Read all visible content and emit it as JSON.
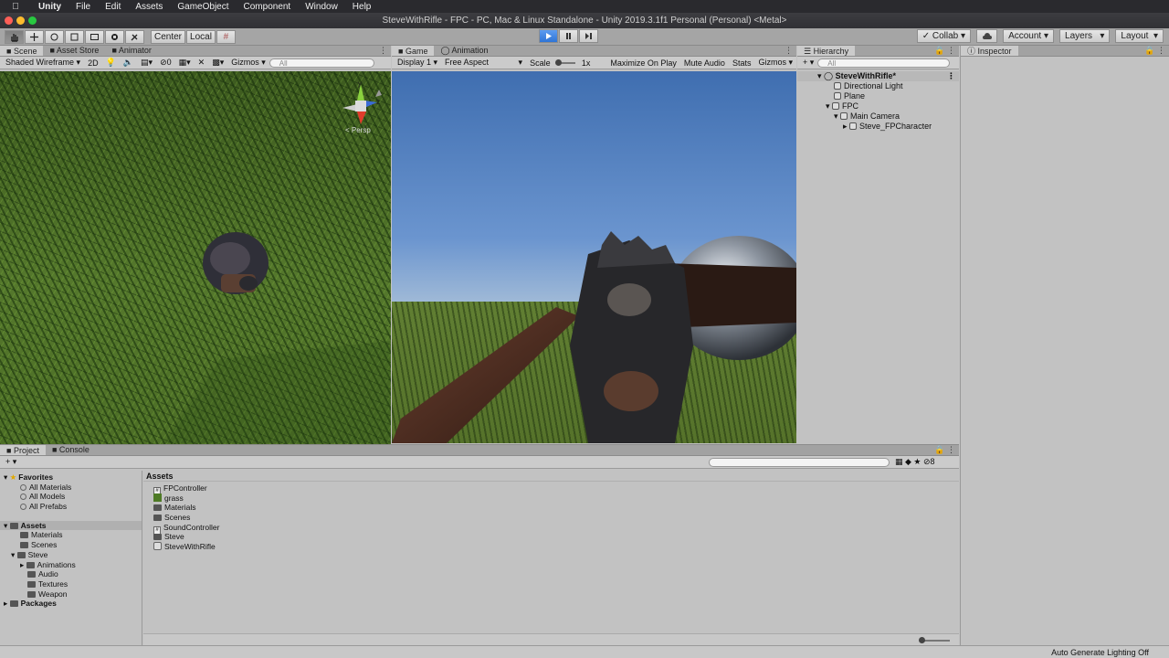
{
  "menubar": {
    "app": "Unity",
    "items": [
      "File",
      "Edit",
      "Assets",
      "GameObject",
      "Component",
      "Window",
      "Help"
    ]
  },
  "window": {
    "title": "SteveWithRifle - FPC - PC, Mac & Linux Standalone - Unity 2019.3.1f1 Personal (Personal) <Metal>"
  },
  "toolbar": {
    "pivot": "Center",
    "space": "Local",
    "collab": "Collab",
    "account": "Account",
    "layers": "Layers",
    "layout": "Layout"
  },
  "scene_panel": {
    "tabs": [
      "Scene",
      "Asset Store",
      "Animator"
    ],
    "shading": "Shaded Wireframe",
    "mode2d": "2D",
    "hidden_count": "0",
    "gizmos": "Gizmos",
    "search_placeholder": "All",
    "gizmo_label": "< Persp",
    "axis_y": "y",
    "axis_x": "x",
    "axis_z": "z"
  },
  "game_panel": {
    "tabs": [
      "Game",
      "Animation"
    ],
    "display": "Display 1",
    "aspect": "Free Aspect",
    "scale_label": "Scale",
    "scale_value": "1x",
    "maximize": "Maximize On Play",
    "mute": "Mute Audio",
    "stats": "Stats",
    "gizmos": "Gizmos"
  },
  "hierarchy": {
    "tab": "Hierarchy",
    "search_placeholder": "All",
    "items": [
      {
        "label": "SteveWithRifle*"
      },
      {
        "label": "Directional Light"
      },
      {
        "label": "Plane"
      },
      {
        "label": "FPC"
      },
      {
        "label": "Main Camera"
      },
      {
        "label": "Steve_FPCharacter"
      }
    ]
  },
  "inspector": {
    "tab": "Inspector"
  },
  "project": {
    "tabs": [
      "Project",
      "Console"
    ],
    "hidden_count": "8",
    "favorites": {
      "label": "Favorites",
      "items": [
        "All Materials",
        "All Models",
        "All Prefabs"
      ]
    },
    "tree": [
      {
        "label": "Assets"
      },
      {
        "label": "Materials"
      },
      {
        "label": "Scenes"
      },
      {
        "label": "Steve"
      },
      {
        "label": "Animations"
      },
      {
        "label": "Audio"
      },
      {
        "label": "Textures"
      },
      {
        "label": "Weapon"
      },
      {
        "label": "Packages"
      }
    ],
    "breadcrumb": "Assets",
    "assets": [
      {
        "label": "FPController",
        "kind": "script"
      },
      {
        "label": "grass",
        "kind": "texture"
      },
      {
        "label": "Materials",
        "kind": "folder"
      },
      {
        "label": "Scenes",
        "kind": "folder"
      },
      {
        "label": "SoundController",
        "kind": "script"
      },
      {
        "label": "Steve",
        "kind": "folder"
      },
      {
        "label": "SteveWithRifle",
        "kind": "scene"
      }
    ]
  },
  "status": {
    "text": "Auto Generate Lighting Off"
  },
  "colors": {
    "selection": "#8fb0e0",
    "play_accent": "#3a86ff"
  }
}
